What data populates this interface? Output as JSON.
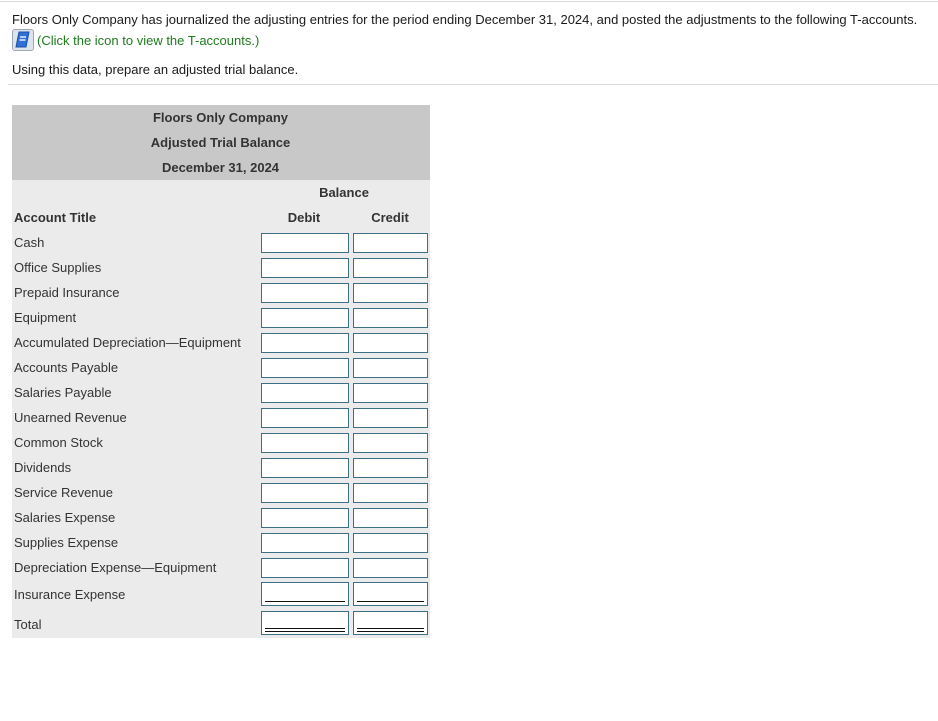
{
  "question": {
    "intro": "Floors Only Company has journalized the adjusting entries for the period ending December 31, 2024, and posted the adjustments to the following T-accounts.",
    "hint_icon": "book-icon",
    "hint_link": "(Click the icon to view the T-accounts.)",
    "instruction": "Using this data, prepare an adjusted trial balance."
  },
  "trial_balance": {
    "company": "Floors Only Company",
    "title": "Adjusted Trial Balance",
    "date": "December 31, 2024",
    "balance_header": "Balance",
    "account_title_header": "Account Title",
    "debit_header": "Debit",
    "credit_header": "Credit",
    "rows": [
      {
        "account": "Cash",
        "debit": "",
        "credit": ""
      },
      {
        "account": "Office Supplies",
        "debit": "",
        "credit": ""
      },
      {
        "account": "Prepaid Insurance",
        "debit": "",
        "credit": ""
      },
      {
        "account": "Equipment",
        "debit": "",
        "credit": ""
      },
      {
        "account": "Accumulated Depreciation—Equipment",
        "debit": "",
        "credit": ""
      },
      {
        "account": "Accounts Payable",
        "debit": "",
        "credit": ""
      },
      {
        "account": "Salaries Payable",
        "debit": "",
        "credit": ""
      },
      {
        "account": "Unearned Revenue",
        "debit": "",
        "credit": ""
      },
      {
        "account": "Common Stock",
        "debit": "",
        "credit": ""
      },
      {
        "account": "Dividends",
        "debit": "",
        "credit": ""
      },
      {
        "account": "Service Revenue",
        "debit": "",
        "credit": ""
      },
      {
        "account": "Salaries Expense",
        "debit": "",
        "credit": ""
      },
      {
        "account": "Supplies Expense",
        "debit": "",
        "credit": ""
      },
      {
        "account": "Depreciation Expense—Equipment",
        "debit": "",
        "credit": ""
      },
      {
        "account": "Insurance Expense",
        "debit": "",
        "credit": ""
      }
    ],
    "total_label": "Total",
    "total_debit": "",
    "total_credit": ""
  }
}
